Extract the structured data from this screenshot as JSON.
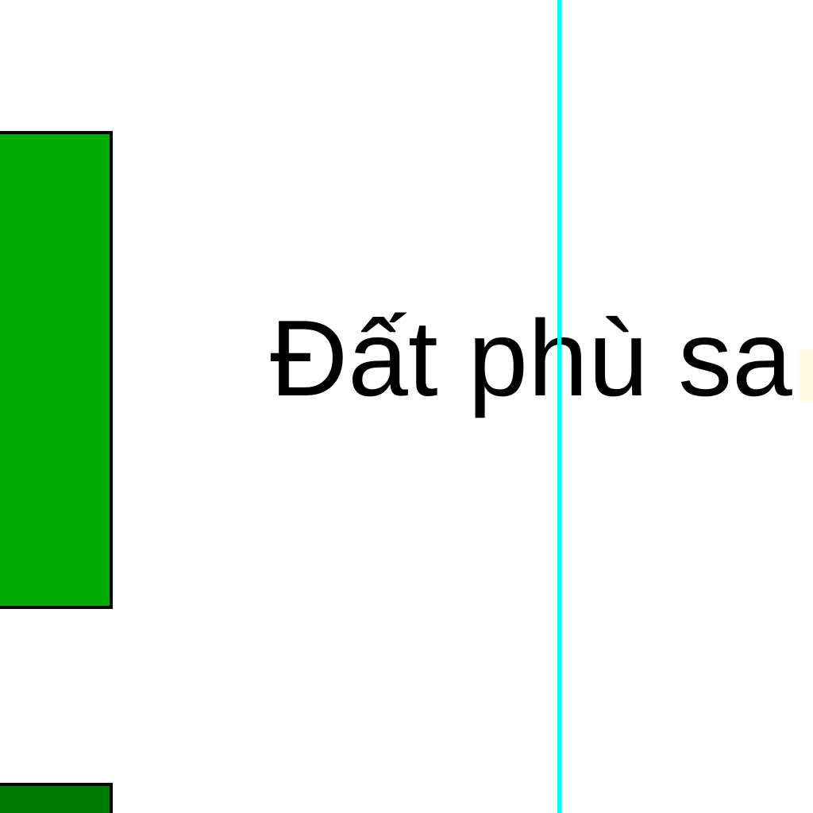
{
  "legend": {
    "items": [
      {
        "label": "Đất phù sa",
        "color": "#00aa00"
      },
      {
        "label": "",
        "color": "#007a00"
      }
    ]
  },
  "colors": {
    "swatch_border": "#000000",
    "guide_line": "#00ffff",
    "background": "#ffffff"
  }
}
